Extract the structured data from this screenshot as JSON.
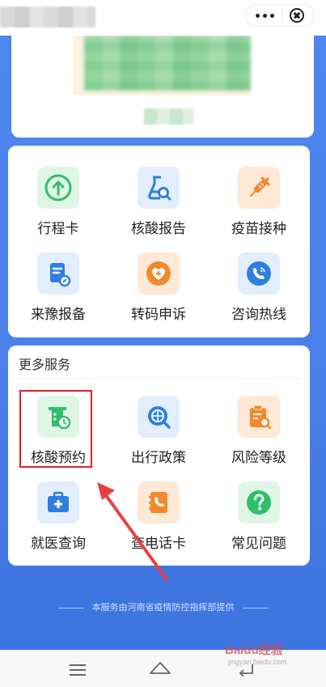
{
  "header": {
    "capsule": {
      "more_icon": "more-dots-icon",
      "close_icon": "close-circle-icon"
    }
  },
  "main_services": [
    {
      "label": "行程卡",
      "icon": "arrow-up-circle-icon",
      "color": "green"
    },
    {
      "label": "核酸报告",
      "icon": "test-tube-search-icon",
      "color": "blue"
    },
    {
      "label": "疫苗接种",
      "icon": "syringe-icon",
      "color": "orange"
    },
    {
      "label": "来豫报备",
      "icon": "document-pen-icon",
      "color": "blue"
    },
    {
      "label": "转码申诉",
      "icon": "heart-plus-icon",
      "color": "orange"
    },
    {
      "label": "咨询热线",
      "icon": "phone-circle-icon",
      "color": "blue"
    }
  ],
  "more_services": {
    "title": "更多服务",
    "items": [
      {
        "label": "核酸预约",
        "icon": "nucleic-appointment-icon",
        "color": "green"
      },
      {
        "label": "出行政策",
        "icon": "globe-search-icon",
        "color": "blue"
      },
      {
        "label": "风险等级",
        "icon": "clipboard-search-icon",
        "color": "orange"
      },
      {
        "label": "就医查询",
        "icon": "medical-kit-icon",
        "color": "blue"
      },
      {
        "label": "查电话卡",
        "icon": "phone-card-icon",
        "color": "orange"
      },
      {
        "label": "常见问题",
        "icon": "question-circle-icon",
        "color": "green"
      }
    ]
  },
  "footer": {
    "note": "本服务由河南省疫情防控指挥部提供"
  },
  "watermark": {
    "brand": "Baidu经验",
    "url": "jingyan.baidu.com"
  },
  "colors": {
    "background_blue": "#4f86f0",
    "green": "#2fbf6a",
    "blue": "#2f7fe0",
    "orange": "#f08a2c",
    "highlight": "#e32020"
  }
}
